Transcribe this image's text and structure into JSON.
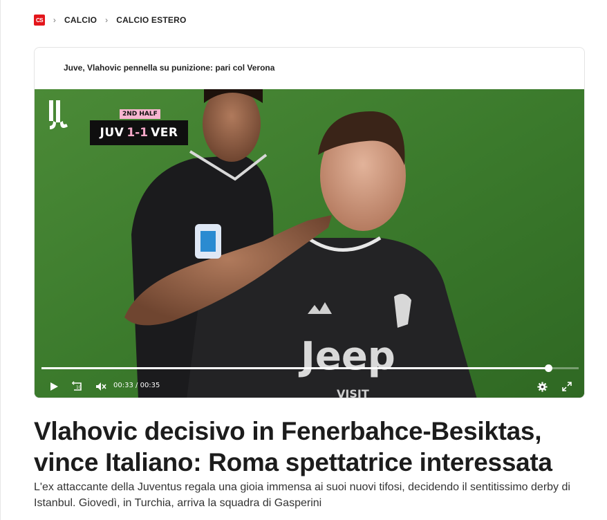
{
  "breadcrumb": {
    "logo_text": "CS",
    "items": [
      {
        "label": "CALCIO"
      },
      {
        "label": "CALCIO ESTERO"
      }
    ]
  },
  "video_card": {
    "title": "Juve, Vlahovic pennella su punizione: pari col Verona",
    "scorebug": {
      "half": "2ND HALF",
      "home": "JUV",
      "score": "1-1",
      "away": "VER"
    },
    "player": {
      "current_time": "00:33",
      "separator": "/",
      "duration": "00:35",
      "progress": 0.943
    },
    "icons": [
      "play-icon",
      "rewind-10-icon",
      "volume-muted-icon",
      "settings-gear-icon",
      "fullscreen-icon"
    ]
  },
  "article": {
    "headline": "Vlahovic decisivo in Fenerbahce-Besiktas, vince Italiano: Roma spettatrice interessata",
    "summary": "L'ex attaccante della Juventus regala una gioia immensa ai suoi nuovi tifosi, decidendo il sentitissimo derby di Istanbul. Giovedì, in Turchia, arriva la squadra di Gasperini"
  },
  "colors": {
    "brand_red": "#e3161c",
    "pitch_green": "#3d7a2e",
    "scorebug_pink": "#f7b5d0"
  }
}
